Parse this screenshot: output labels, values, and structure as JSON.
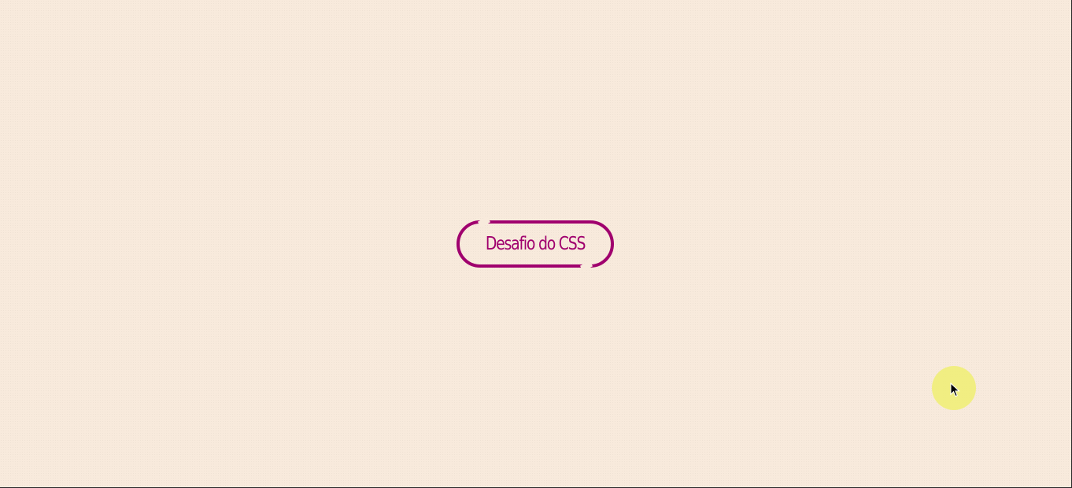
{
  "button": {
    "label": "Desafio do CSS"
  },
  "colors": {
    "background": "#f8eadc",
    "accent": "#a0006e",
    "cursor_highlight": "#f0ee78"
  },
  "cursor": {
    "icon": "arrow-pointer-icon"
  }
}
